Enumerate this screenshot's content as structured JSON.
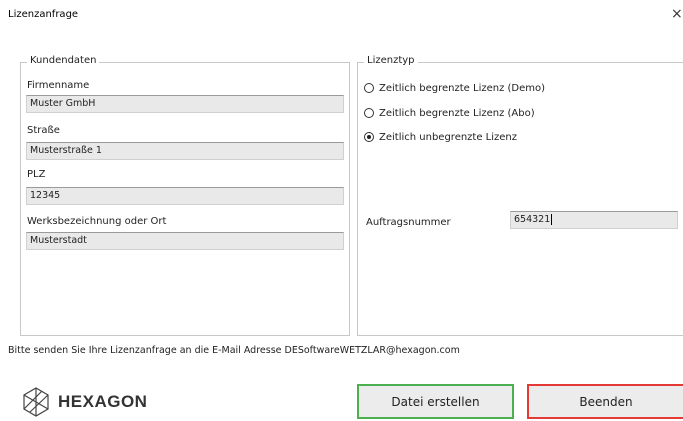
{
  "window": {
    "title": "Lizenzanfrage",
    "close_glyph": "×"
  },
  "customer": {
    "legend": "Kundendaten",
    "fields": [
      {
        "label": "Firmenname",
        "value": "Muster GmbH"
      },
      {
        "label": "Straße",
        "value": "Musterstraße 1"
      },
      {
        "label": "PLZ",
        "value": "12345"
      },
      {
        "label": "Werksbezeichnung oder Ort",
        "value": "Musterstadt"
      }
    ]
  },
  "license": {
    "legend": "Lizenztyp",
    "options": [
      {
        "label": "Zeitlich begrenzte Lizenz (Demo)",
        "checked": false
      },
      {
        "label": "Zeitlich begrenzte Lizenz (Abo)",
        "checked": false
      },
      {
        "label": "Zeitlich unbegrenzte Lizenz",
        "checked": true
      }
    ],
    "order_label": "Auftragsnummer",
    "order_value": "654321"
  },
  "info_text": "Bitte senden Sie Ihre Lizenzanfrage an die E-Mail Adresse DESoftwareWETZLAR@hexagon.com",
  "logo": {
    "text": "HEXAGON",
    "icon": "hexagon-logo-icon"
  },
  "buttons": {
    "create_label": "Datei erstellen",
    "exit_label": "Beenden"
  },
  "colors": {
    "create_border": "#4caf50",
    "exit_border": "#e53935",
    "field_bg": "#e9e9e9"
  }
}
